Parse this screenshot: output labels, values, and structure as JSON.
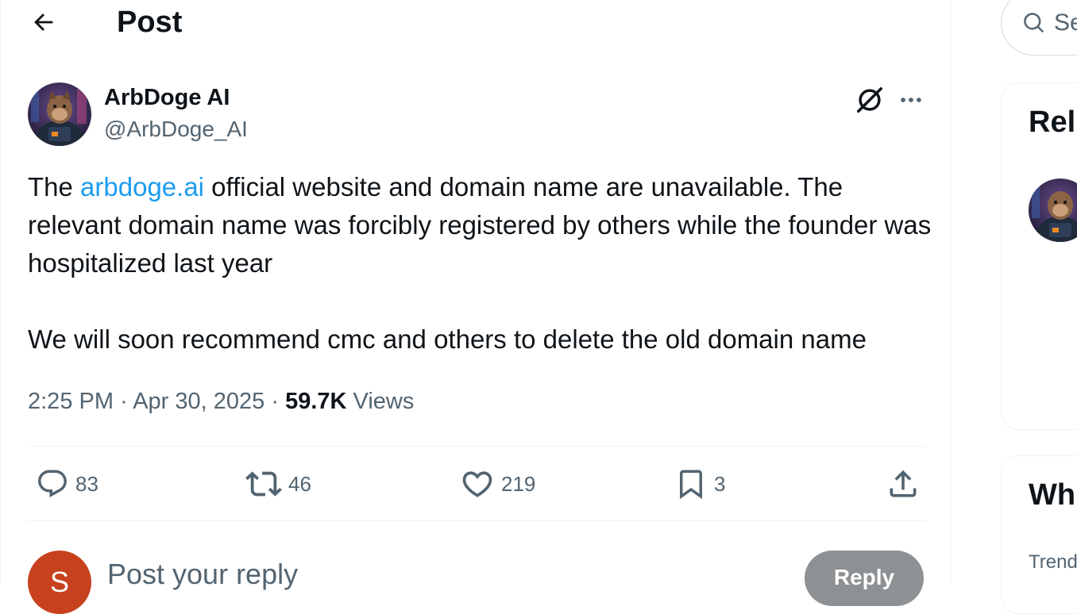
{
  "header": {
    "title": "Post"
  },
  "post": {
    "author": {
      "name": "ArbDoge AI",
      "handle": "@ArbDoge_AI"
    },
    "text": {
      "before_link": "The ",
      "link": "arbdoge.ai",
      "after_link": " official website and domain name are unavailable. The relevant domain name was forcibly registered by others while the founder was hospitalized last year",
      "paragraph2": "We will soon recommend cmc and others to delete the old domain name"
    },
    "meta": {
      "time": "2:25 PM",
      "separator": "·",
      "date": "Apr 30, 2025",
      "views_count": "59.7K",
      "views_label": "Views"
    },
    "stats": {
      "replies": "83",
      "reposts": "46",
      "likes": "219",
      "bookmarks": "3"
    }
  },
  "reply_box": {
    "avatar_initial": "S",
    "placeholder": "Post your reply",
    "button_label": "Reply"
  },
  "sidebar": {
    "search_placeholder": "Se",
    "relevant_title": "Rel",
    "whats_happening_title": "Wh",
    "trending_label": "Trend"
  },
  "colors": {
    "accent": "#1d9bf0",
    "text": "#0f1419",
    "muted": "#536471",
    "reply_avatar": "#c7411e",
    "reply_button": "#8e9193"
  },
  "icons": [
    "back-arrow-icon",
    "grok-icon",
    "more-icon",
    "reply-icon",
    "repost-icon",
    "like-icon",
    "bookmark-icon",
    "share-icon",
    "search-icon"
  ]
}
